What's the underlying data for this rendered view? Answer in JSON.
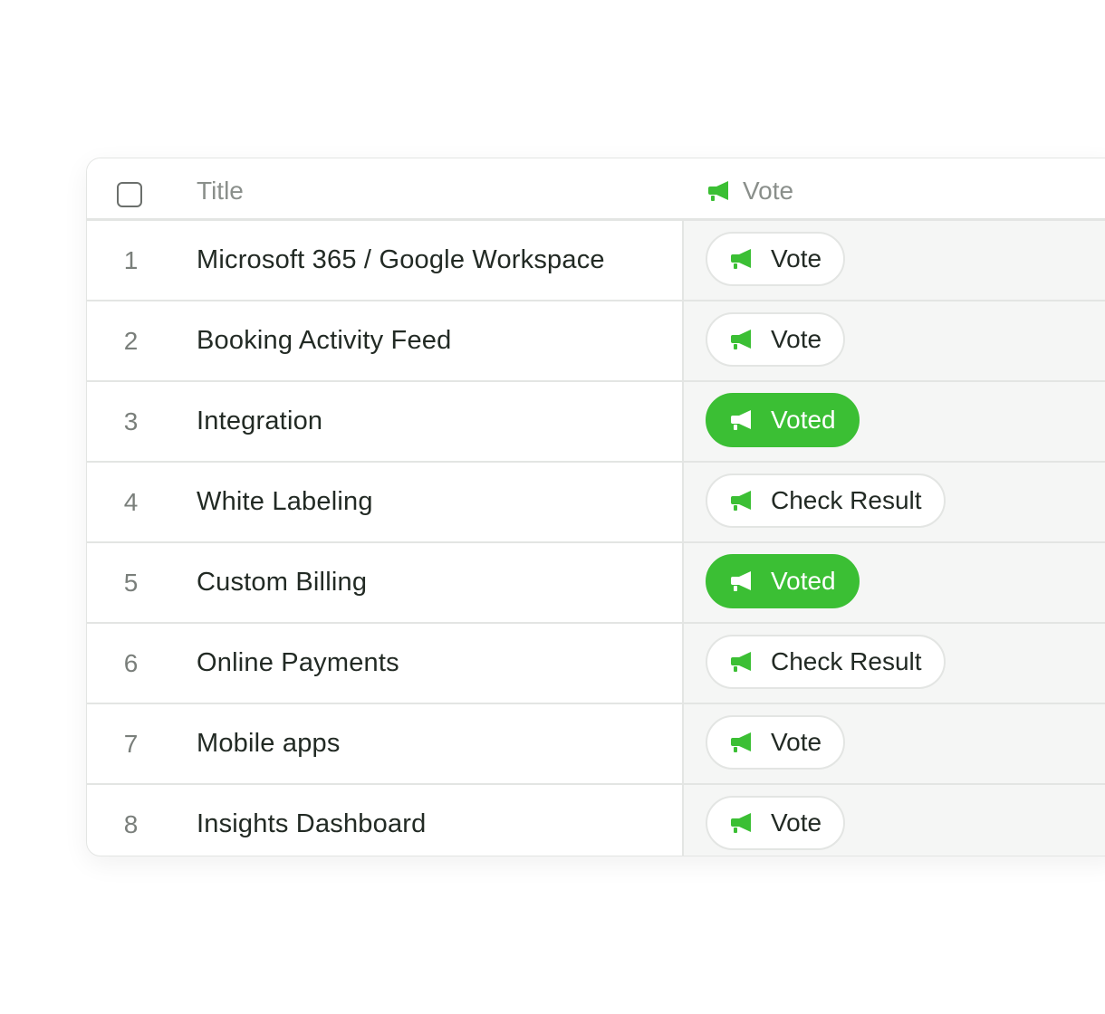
{
  "colors": {
    "accent": "#3bbf34",
    "border": "#e3e5e3",
    "cell_bg": "#f5f6f5",
    "header_text": "#8a8f8b"
  },
  "header": {
    "title_label": "Title",
    "vote_label": "Vote",
    "vote_icon": "megaphone-icon"
  },
  "rows": [
    {
      "num": "1",
      "title": "Microsoft 365 / Google Workspace",
      "action": "Vote",
      "state": "vote"
    },
    {
      "num": "2",
      "title": "Booking Activity Feed",
      "action": "Vote",
      "state": "vote"
    },
    {
      "num": "3",
      "title": "Integration",
      "action": "Voted",
      "state": "voted"
    },
    {
      "num": "4",
      "title": "White Labeling",
      "action": "Check Result",
      "state": "result"
    },
    {
      "num": "5",
      "title": "Custom Billing",
      "action": "Voted",
      "state": "voted"
    },
    {
      "num": "6",
      "title": "Online Payments",
      "action": "Check Result",
      "state": "result"
    },
    {
      "num": "7",
      "title": "Mobile apps",
      "action": "Vote",
      "state": "vote"
    },
    {
      "num": "8",
      "title": "Insights Dashboard",
      "action": "Vote",
      "state": "vote"
    }
  ]
}
